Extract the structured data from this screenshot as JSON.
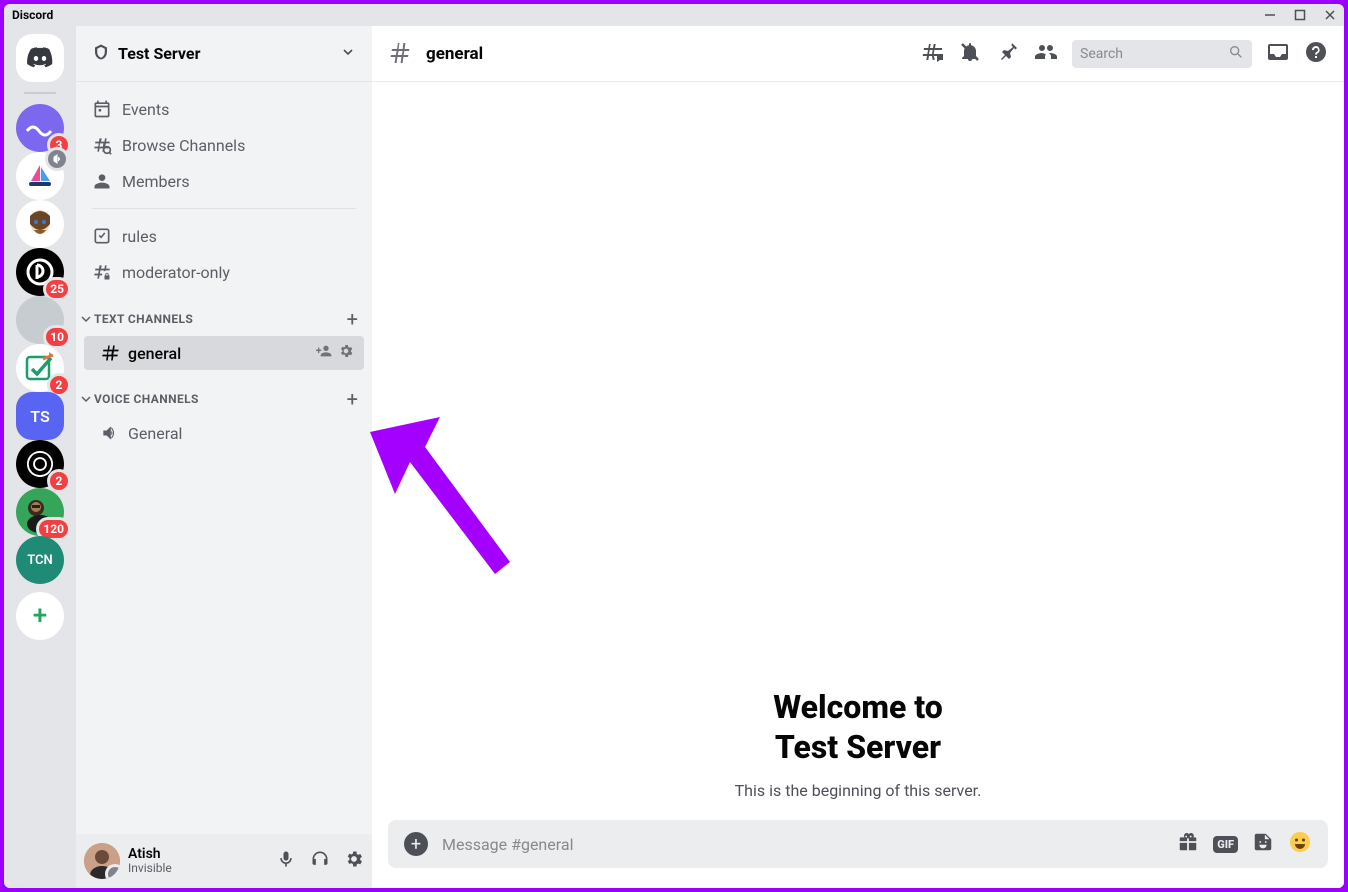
{
  "titlebar": {
    "title": "Discord"
  },
  "server_rail": {
    "items": [
      {
        "type": "home"
      },
      {
        "bg": "#7b68ee",
        "svg": "wave",
        "badge": 3
      },
      {
        "bg": "#ffffff",
        "svg": "sailboat",
        "muted": true
      },
      {
        "bg": "#ffffff",
        "svg": "face"
      },
      {
        "bg": "#000000",
        "svg": "pcircle",
        "badge": 25
      },
      {
        "bg": "#c7ccd1",
        "svg": "none",
        "badge": 10
      },
      {
        "bg": "#ffffff",
        "svg": "check-arrow",
        "badge": 2
      },
      {
        "bg": "#5865f2",
        "text": "TS",
        "rounded": true
      },
      {
        "bg": "#000000",
        "svg": "openai",
        "badge": 2
      },
      {
        "bg": "#35a55a",
        "svg": "person-green",
        "badge": 120
      },
      {
        "bg": "#1f8b76",
        "text": "TCN",
        "text_small": true
      }
    ]
  },
  "server_header": {
    "name": "Test Server"
  },
  "channels": {
    "top_items": [
      {
        "icon": "calendar",
        "label": "Events",
        "name": "events"
      },
      {
        "icon": "browse",
        "label": "Browse Channels",
        "name": "browse-channels"
      },
      {
        "icon": "members",
        "label": "Members",
        "name": "members"
      }
    ],
    "loose": [
      {
        "icon": "rules",
        "label": "rules",
        "name": "rules"
      },
      {
        "icon": "hash-lock",
        "label": "moderator-only",
        "name": "moderator-only"
      }
    ],
    "categories": [
      {
        "label": "TEXT CHANNELS",
        "channels": [
          {
            "icon": "hash",
            "label": "general",
            "active": true,
            "name": "general",
            "show_actions": true
          }
        ]
      },
      {
        "label": "VOICE CHANNELS",
        "channels": [
          {
            "icon": "speaker",
            "label": "General",
            "name": "voice-general"
          }
        ]
      }
    ]
  },
  "user_panel": {
    "name": "Atish",
    "status": "Invisible"
  },
  "chat_header": {
    "channel_name": "general",
    "search_placeholder": "Search"
  },
  "welcome": {
    "line1": "Welcome to",
    "line2": "Test Server",
    "subtitle": "This is the beginning of this server."
  },
  "composer": {
    "placeholder": "Message #general"
  }
}
